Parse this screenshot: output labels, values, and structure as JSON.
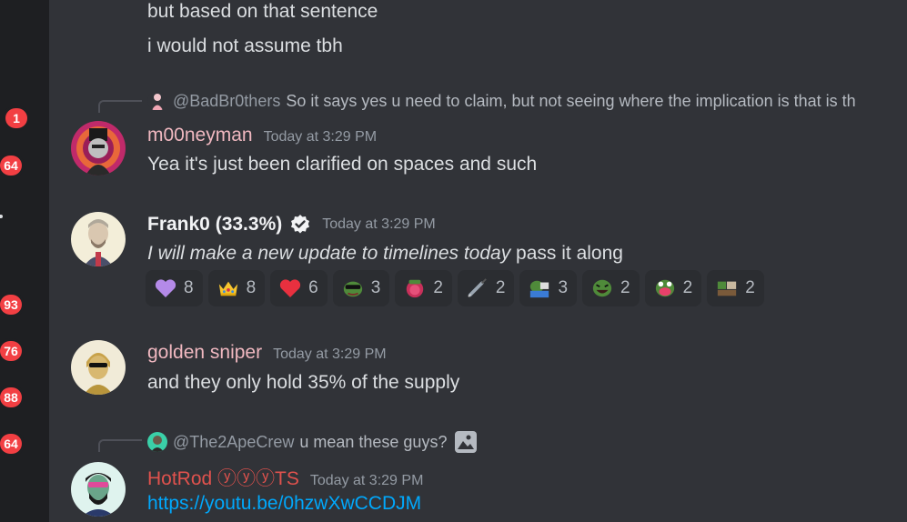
{
  "sidebar": {
    "badges": [
      "1",
      "64",
      "93",
      "76",
      "88",
      "64"
    ]
  },
  "messages": {
    "prev": {
      "line1": "but based on that sentence",
      "line2": "i would not assume tbh"
    },
    "m1": {
      "reply_mention": "@BadBr0thers",
      "reply_text": "So it says yes u need to claim, but not seeing where the implication is that is th",
      "username": "m00neyman",
      "username_color": "#f0b8c0",
      "timestamp": "Today at 3:29 PM",
      "text": "Yea it's just been clarified on spaces and such"
    },
    "m2": {
      "username": "Frank0 (33.3%)",
      "username_color": "#f2f3f5",
      "timestamp": "Today at 3:29 PM",
      "text_italic": "I will make a new update to timelines today",
      "text_rest": " pass it along",
      "reactions": [
        {
          "icon": "purple-heart-icon",
          "count": "8"
        },
        {
          "icon": "crown-icon",
          "count": "8"
        },
        {
          "icon": "red-heart-icon",
          "count": "6"
        },
        {
          "icon": "pepe-sunglasses-icon",
          "count": "3"
        },
        {
          "icon": "pink-blob-icon",
          "count": "2"
        },
        {
          "icon": "syringe-icon",
          "count": "2"
        },
        {
          "icon": "pepe-computer-icon",
          "count": "3"
        },
        {
          "icon": "pepe-laugh-icon",
          "count": "2"
        },
        {
          "icon": "pepe-scream-icon",
          "count": "2"
        },
        {
          "icon": "pepe-desk-icon",
          "count": "2"
        }
      ]
    },
    "m3": {
      "username": "golden sniper",
      "username_color": "#f0b8c0",
      "timestamp": "Today at 3:29 PM",
      "text": "and they only hold 35% of the supply"
    },
    "m4": {
      "reply_mention": "@The2ApeCrew",
      "reply_text": "u mean these guys?",
      "username": "HotRod ⓨⓨⓨTS",
      "username_color": "#e0524d",
      "timestamp": "Today at 3:29 PM",
      "link": "https://youtu.be/0hzwXwCCDJM"
    }
  }
}
